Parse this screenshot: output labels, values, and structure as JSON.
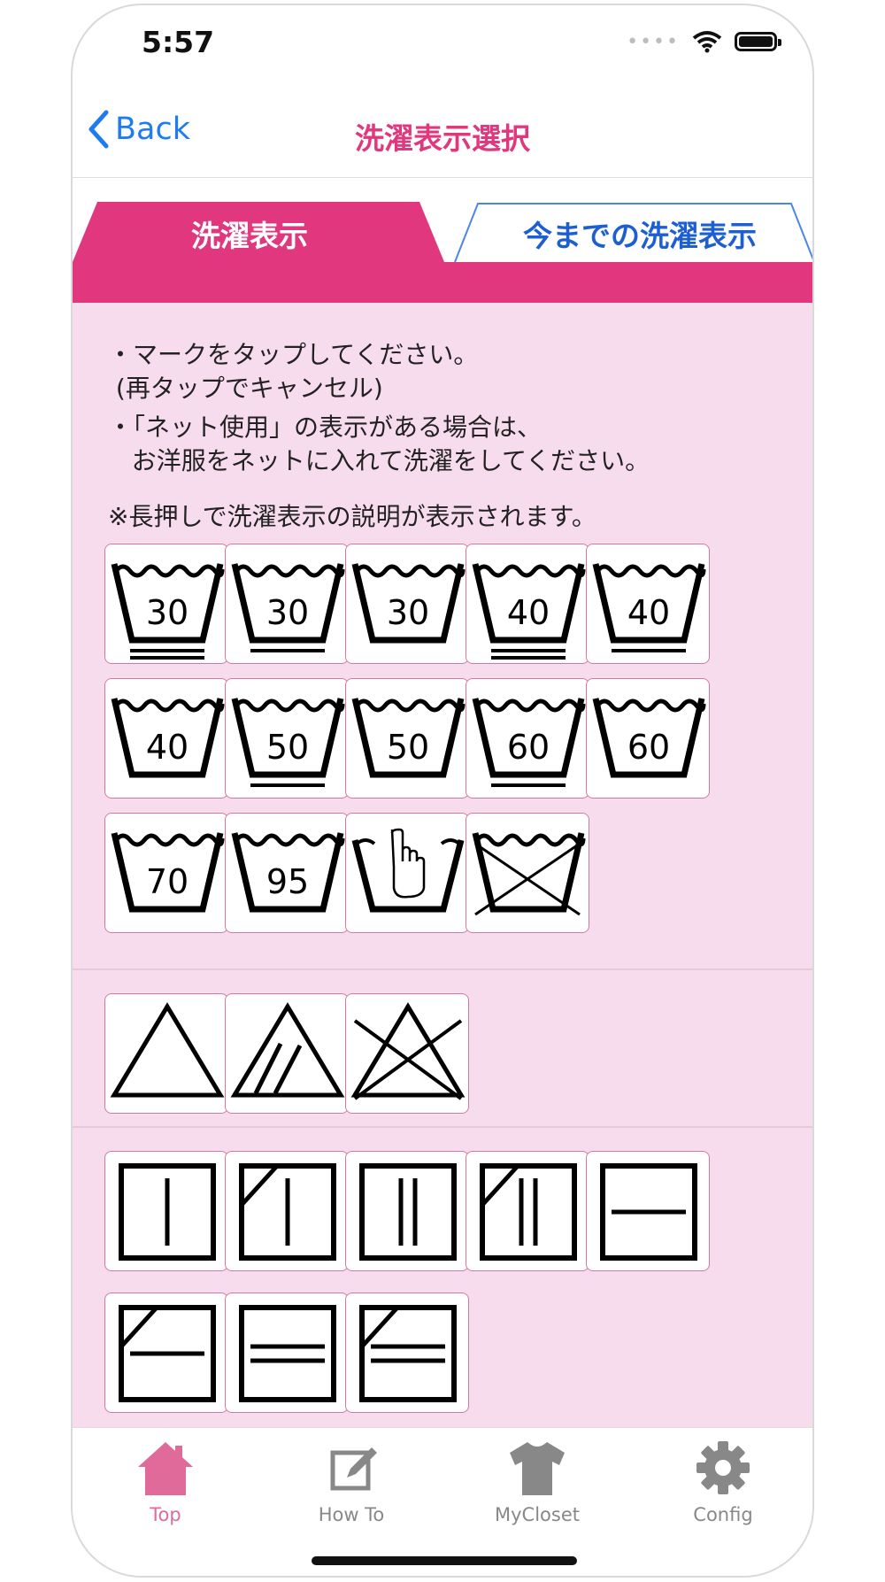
{
  "status_bar": {
    "time": "5:57"
  },
  "navbar": {
    "back_label": "Back",
    "title": "洗濯表示選択"
  },
  "tabs": {
    "active_label": "洗濯表示",
    "inactive_label": "今までの洗濯表示"
  },
  "instructions": {
    "line1": "・マークをタップしてください。",
    "line2": " (再タップでキャンセル)",
    "line3": "・「ネット使用」の表示がある場合は、",
    "line4": "   お洋服をネットに入れて洗濯をしてください。",
    "note": "※長押しで洗濯表示の説明が表示されます。"
  },
  "wash_symbols": [
    {
      "temp": "30",
      "bars": 2
    },
    {
      "temp": "30",
      "bars": 1
    },
    {
      "temp": "30",
      "bars": 0
    },
    {
      "temp": "40",
      "bars": 2
    },
    {
      "temp": "40",
      "bars": 1
    },
    {
      "temp": "40",
      "bars": 0
    },
    {
      "temp": "50",
      "bars": 1
    },
    {
      "temp": "50",
      "bars": 0
    },
    {
      "temp": "60",
      "bars": 1
    },
    {
      "temp": "60",
      "bars": 0
    },
    {
      "temp": "70",
      "bars": 0
    },
    {
      "temp": "95",
      "bars": 0
    },
    {
      "icon": "hand-wash-icon"
    },
    {
      "icon": "do-not-wash-icon"
    }
  ],
  "bleach_symbols": [
    "bleach-allowed-icon",
    "oxygen-bleach-only-icon",
    "do-not-bleach-icon"
  ],
  "dry_symbols": [
    "line-dry-icon",
    "line-dry-shade-icon",
    "drip-dry-icon",
    "drip-dry-shade-icon",
    "flat-dry-icon",
    "flat-dry-shade-icon",
    "drip-flat-dry-icon",
    "drip-flat-dry-shade-icon"
  ],
  "tabbar": [
    {
      "label": "Top",
      "icon": "home-icon",
      "active": true
    },
    {
      "label": "How To",
      "icon": "edit-icon",
      "active": false
    },
    {
      "label": "MyCloset",
      "icon": "tshirt-icon",
      "active": false
    },
    {
      "label": "Config",
      "icon": "gear-icon",
      "active": false
    }
  ],
  "colors": {
    "accent_pink": "#e0377e",
    "content_bg": "#f7dced",
    "link_blue": "#1d7cf2",
    "tab_blue": "#1d5fd1"
  }
}
